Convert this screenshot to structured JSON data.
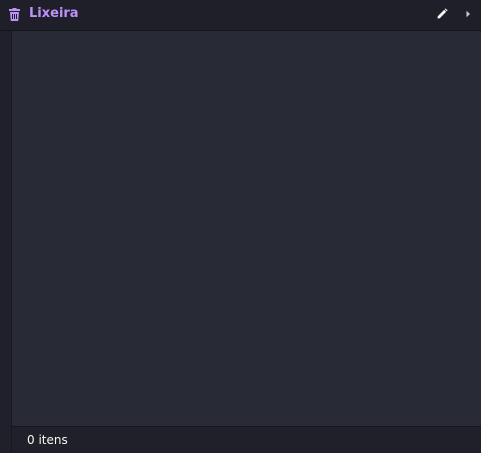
{
  "header": {
    "title": "Lixeira",
    "title_color": "#bd93f9",
    "icon": "trash-icon",
    "actions": [
      {
        "name": "edit",
        "icon": "pencil-icon"
      },
      {
        "name": "expand",
        "icon": "chevron-right-icon"
      }
    ]
  },
  "content": {
    "items": []
  },
  "footer": {
    "count_label": "0 itens"
  },
  "colors": {
    "background": "#1e1f29",
    "content_background": "#282a36",
    "accent": "#bd93f9",
    "text": "#f8f8f2"
  }
}
